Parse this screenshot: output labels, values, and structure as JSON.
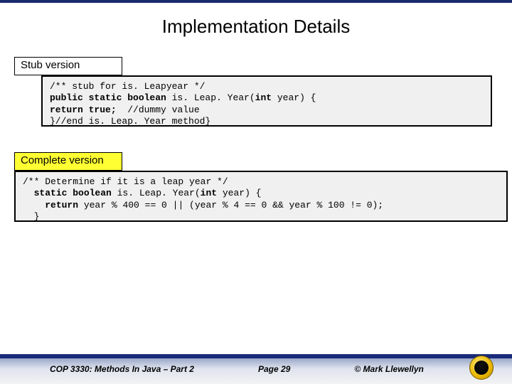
{
  "title": "Implementation Details",
  "labels": {
    "stub": "Stub version",
    "complete": "Complete version"
  },
  "code": {
    "stub": {
      "line1_a": "/** stub for is. Leapyear */",
      "line2_kw": "public static boolean",
      "line2_b": " is. Leap. Year(",
      "line2_kw2": "int",
      "line2_c": " year) {",
      "line3_kw": "return true;",
      "line3_b": "  //dummy value",
      "line4_a": "}//end is. Leap. Year method}"
    },
    "complete": {
      "line1": "/** Determine if it is a leap year */",
      "line2_pad": "  ",
      "line2_kw": "static boolean",
      "line2_b": " is. Leap. Year(",
      "line2_kw2": "int",
      "line2_c": " year) {",
      "line3_pad": "    ",
      "line3_kw": "return",
      "line3_b": " year % 400 == 0 || (year % 4 == 0 && year % 100 != 0);",
      "line4_pad": "  ",
      "line4": "}"
    }
  },
  "footer": {
    "course": "COP 3330: Methods In Java – Part 2",
    "page": "Page 29",
    "copyright": "© Mark Llewellyn"
  }
}
